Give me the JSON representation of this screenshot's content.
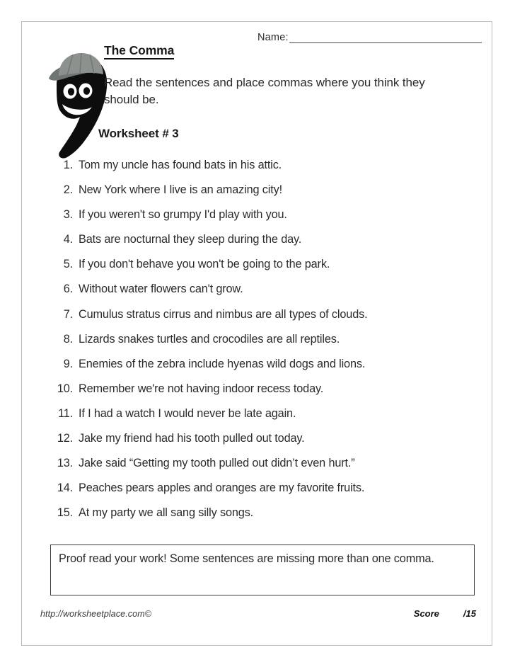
{
  "header": {
    "name_label": "Name:",
    "name_value": "",
    "title": "The Comma",
    "instructions": "Read the sentences and place commas where you think they should be.",
    "worksheet_number": "Worksheet # 3"
  },
  "mascot": {
    "icon": "comma-character-icon",
    "body_color": "#0d0d0d",
    "cap_color": "#8c918e",
    "cap_brim_color": "#6f7573",
    "face_color": "#ffffff"
  },
  "questions": [
    {
      "number": "1.",
      "text": "Tom my uncle has found bats in his attic."
    },
    {
      "number": "2.",
      "text": "New York where I live is an amazing city!"
    },
    {
      "number": "3.",
      "text": "If you weren't so grumpy I'd play with you."
    },
    {
      "number": "4.",
      "text": "Bats are nocturnal they sleep during the day."
    },
    {
      "number": "5.",
      "text": "If you don't behave you won't be going to the park."
    },
    {
      "number": "6.",
      "text": "Without water flowers can't grow."
    },
    {
      "number": "7.",
      "text": "Cumulus stratus cirrus and nimbus are all types of clouds."
    },
    {
      "number": "8.",
      "text": "Lizards snakes turtles and crocodiles are all reptiles."
    },
    {
      "number": "9.",
      "text": "Enemies of the zebra include hyenas wild dogs and lions."
    },
    {
      "number": "10.",
      "text": "Remember we're not having indoor recess today."
    },
    {
      "number": "11.",
      "text": "If I had a watch I would never be late again."
    },
    {
      "number": "12.",
      "text": "Jake my friend had his tooth pulled out today."
    },
    {
      "number": "13.",
      "text": "Jake said “Getting my tooth pulled out didn’t even hurt.”"
    },
    {
      "number": "14.",
      "text": "Peaches pears apples and oranges are my favorite fruits."
    },
    {
      "number": "15.",
      "text": "At my party we all sang silly songs."
    }
  ],
  "note": {
    "text": "Proof read your work! Some sentences are missing more than one comma."
  },
  "footer": {
    "url": "http://worksheetplace.com©",
    "score_label": "Score",
    "score_total": "/15"
  }
}
